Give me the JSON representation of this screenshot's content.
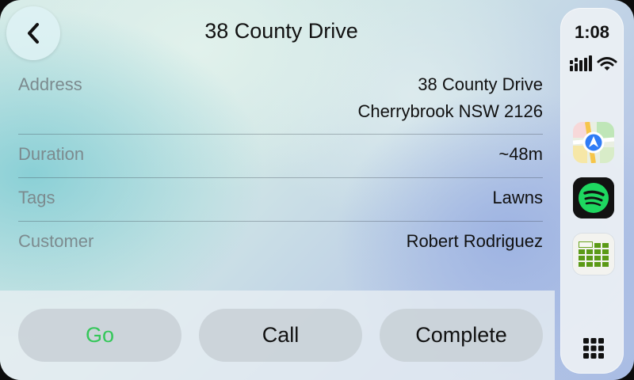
{
  "header": {
    "title": "38 County Drive",
    "back_icon": "chevron-left-icon"
  },
  "details": {
    "address": {
      "label": "Address",
      "line1": "38 County Drive",
      "line2": "Cherrybrook NSW 2126"
    },
    "duration": {
      "label": "Duration",
      "value": "~48m"
    },
    "tags": {
      "label": "Tags",
      "value": "Lawns"
    },
    "customer": {
      "label": "Customer",
      "value": "Robert Rodriguez"
    }
  },
  "actions": {
    "go_label": "Go",
    "call_label": "Call",
    "complete_label": "Complete"
  },
  "dock": {
    "time": "1:08",
    "signal_icon": "cellular-signal-icon",
    "wifi_icon": "wifi-icon",
    "apps": [
      "maps-app-icon",
      "spotify-app-icon",
      "spreadsheet-app-icon"
    ],
    "launcher_icon": "app-grid-icon"
  },
  "colors": {
    "go_green": "#34c759",
    "spotify_green": "#1ed760"
  }
}
